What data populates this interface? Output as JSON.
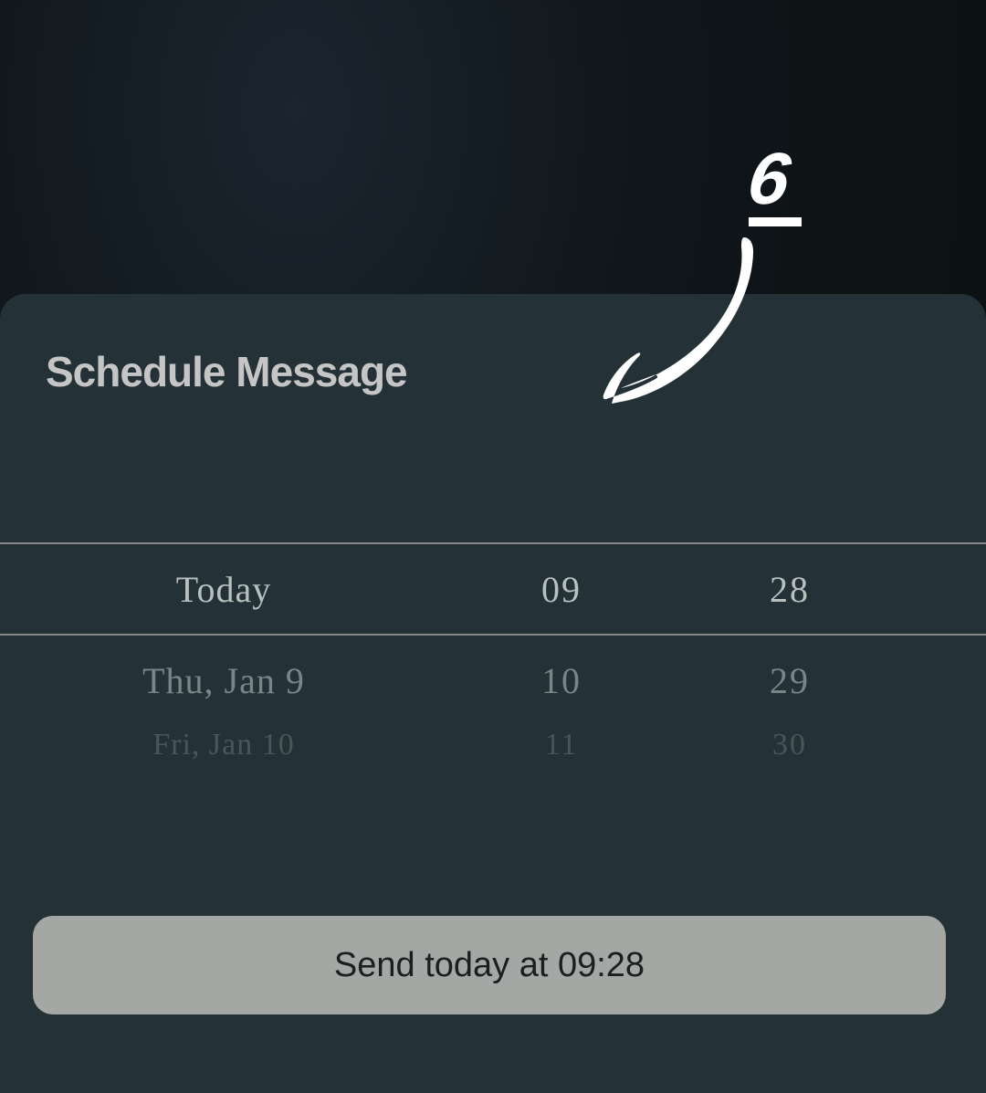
{
  "annotation": {
    "number": "6"
  },
  "sheet": {
    "title": "Schedule Message"
  },
  "picker": {
    "dates": {
      "selected": "Today",
      "next": "Thu, Jan 9",
      "faded": "Fri, Jan 10"
    },
    "hours": {
      "selected": "09",
      "next": "10",
      "faded": "11"
    },
    "minutes": {
      "selected": "28",
      "next": "29",
      "faded": "30"
    }
  },
  "button": {
    "send_label": "Send today at 09:28"
  }
}
